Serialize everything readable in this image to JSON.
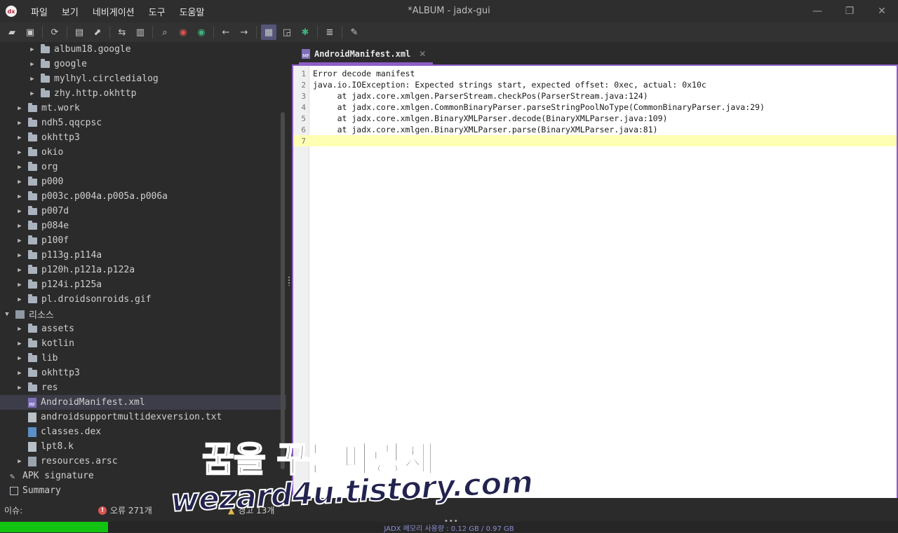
{
  "window": {
    "title": "*ALBUM - jadx-gui",
    "app_icon": "jadx-logo-icon",
    "controls": [
      "—",
      "❐",
      "✕"
    ]
  },
  "menu": [
    "파일",
    "보기",
    "네비게이션",
    "도구",
    "도움말"
  ],
  "toolbar": {
    "buttons": [
      "open-icon",
      "add-files-icon",
      "reload-icon",
      "save-icon",
      "export-icon",
      "sync-icon",
      "open-folder-icon",
      "search-icon",
      "find-usage-icon",
      "find-class-icon",
      "back-icon",
      "forward-icon",
      "decompile-mode-icon",
      "bookmark-icon",
      "debug-icon",
      "log-icon",
      "settings-icon"
    ]
  },
  "tree": {
    "items": [
      {
        "label": "album18.google",
        "type": "folder",
        "expandable": true
      },
      {
        "label": "google",
        "type": "folder",
        "expandable": true
      },
      {
        "label": "mylhyl.circledialog",
        "type": "folder",
        "expandable": true
      },
      {
        "label": "zhy.http.okhttp",
        "type": "folder",
        "expandable": true
      },
      {
        "label": "mt.work",
        "type": "folder",
        "expandable": true
      },
      {
        "label": "ndh5.qqcpsc",
        "type": "folder",
        "expandable": true
      },
      {
        "label": "okhttp3",
        "type": "folder",
        "expandable": true
      },
      {
        "label": "okio",
        "type": "folder",
        "expandable": true
      },
      {
        "label": "org",
        "type": "folder",
        "expandable": true
      },
      {
        "label": "p000",
        "type": "folder",
        "expandable": true
      },
      {
        "label": "p003c.p004a.p005a.p006a",
        "type": "folder",
        "expandable": true
      },
      {
        "label": "p007d",
        "type": "folder",
        "expandable": true
      },
      {
        "label": "p084e",
        "type": "folder",
        "expandable": true
      },
      {
        "label": "p100f",
        "type": "folder",
        "expandable": true
      },
      {
        "label": "p113g.p114a",
        "type": "folder",
        "expandable": true
      },
      {
        "label": "p120h.p121a.p122a",
        "type": "folder",
        "expandable": true
      },
      {
        "label": "p124i.p125a",
        "type": "folder",
        "expandable": true
      },
      {
        "label": "pl.droidsonroids.gif",
        "type": "folder",
        "expandable": true
      },
      {
        "label": "리소스",
        "type": "resources",
        "expanded": true
      },
      {
        "label": "assets",
        "type": "folder",
        "expandable": true
      },
      {
        "label": "kotlin",
        "type": "folder",
        "expandable": true
      },
      {
        "label": "lib",
        "type": "folder",
        "expandable": true
      },
      {
        "label": "okhttp3",
        "type": "folder",
        "expandable": true
      },
      {
        "label": "res",
        "type": "folder",
        "expandable": true
      },
      {
        "label": "AndroidManifest.xml",
        "type": "manifest",
        "selected": true
      },
      {
        "label": "androidsupportmultidexversion.txt",
        "type": "file"
      },
      {
        "label": "classes.dex",
        "type": "dex"
      },
      {
        "label": "lpt8.k",
        "type": "file"
      },
      {
        "label": "resources.arsc",
        "type": "arsc",
        "expandable": true
      },
      {
        "label": "APK signature",
        "type": "signature"
      },
      {
        "label": "Summary",
        "type": "summary"
      }
    ]
  },
  "tab": {
    "label": "AndroidManifest.xml",
    "icon_text": "MF",
    "close": "✕"
  },
  "editor": {
    "lines": [
      {
        "n": "1",
        "text": "Error decode manifest"
      },
      {
        "n": "2",
        "text": "java.io.IOException: Expected strings start, expected offset: 0xec, actual: 0x10c"
      },
      {
        "n": "3",
        "text": "     at jadx.core.xmlgen.ParserStream.checkPos(ParserStream.java:124)"
      },
      {
        "n": "4",
        "text": "     at jadx.core.xmlgen.CommonBinaryParser.parseStringPoolNoType(CommonBinaryParser.java:29)"
      },
      {
        "n": "5",
        "text": "     at jadx.core.xmlgen.BinaryXMLParser.decode(BinaryXMLParser.java:109)"
      },
      {
        "n": "6",
        "text": "     at jadx.core.xmlgen.BinaryXMLParser.parse(BinaryXMLParser.java:81)"
      },
      {
        "n": "7",
        "text": ""
      }
    ],
    "current_line": 7
  },
  "status": {
    "issues_label": "이슈:",
    "errors": "오류 271개",
    "warnings": "경고 13개"
  },
  "memory": {
    "text": "JADX 메모리 사용량 : 0.12 GB / 0.97 GB",
    "used_fraction": 0.12
  },
  "watermark": {
    "line1": "꿈을 꾸는파랑새",
    "line2": "wezard4u.tistory.com"
  },
  "colors": {
    "accent": "#8d5ec6",
    "memory_fill": "#12c312",
    "current_line": "#ffffb4",
    "error": "#d9534f"
  }
}
